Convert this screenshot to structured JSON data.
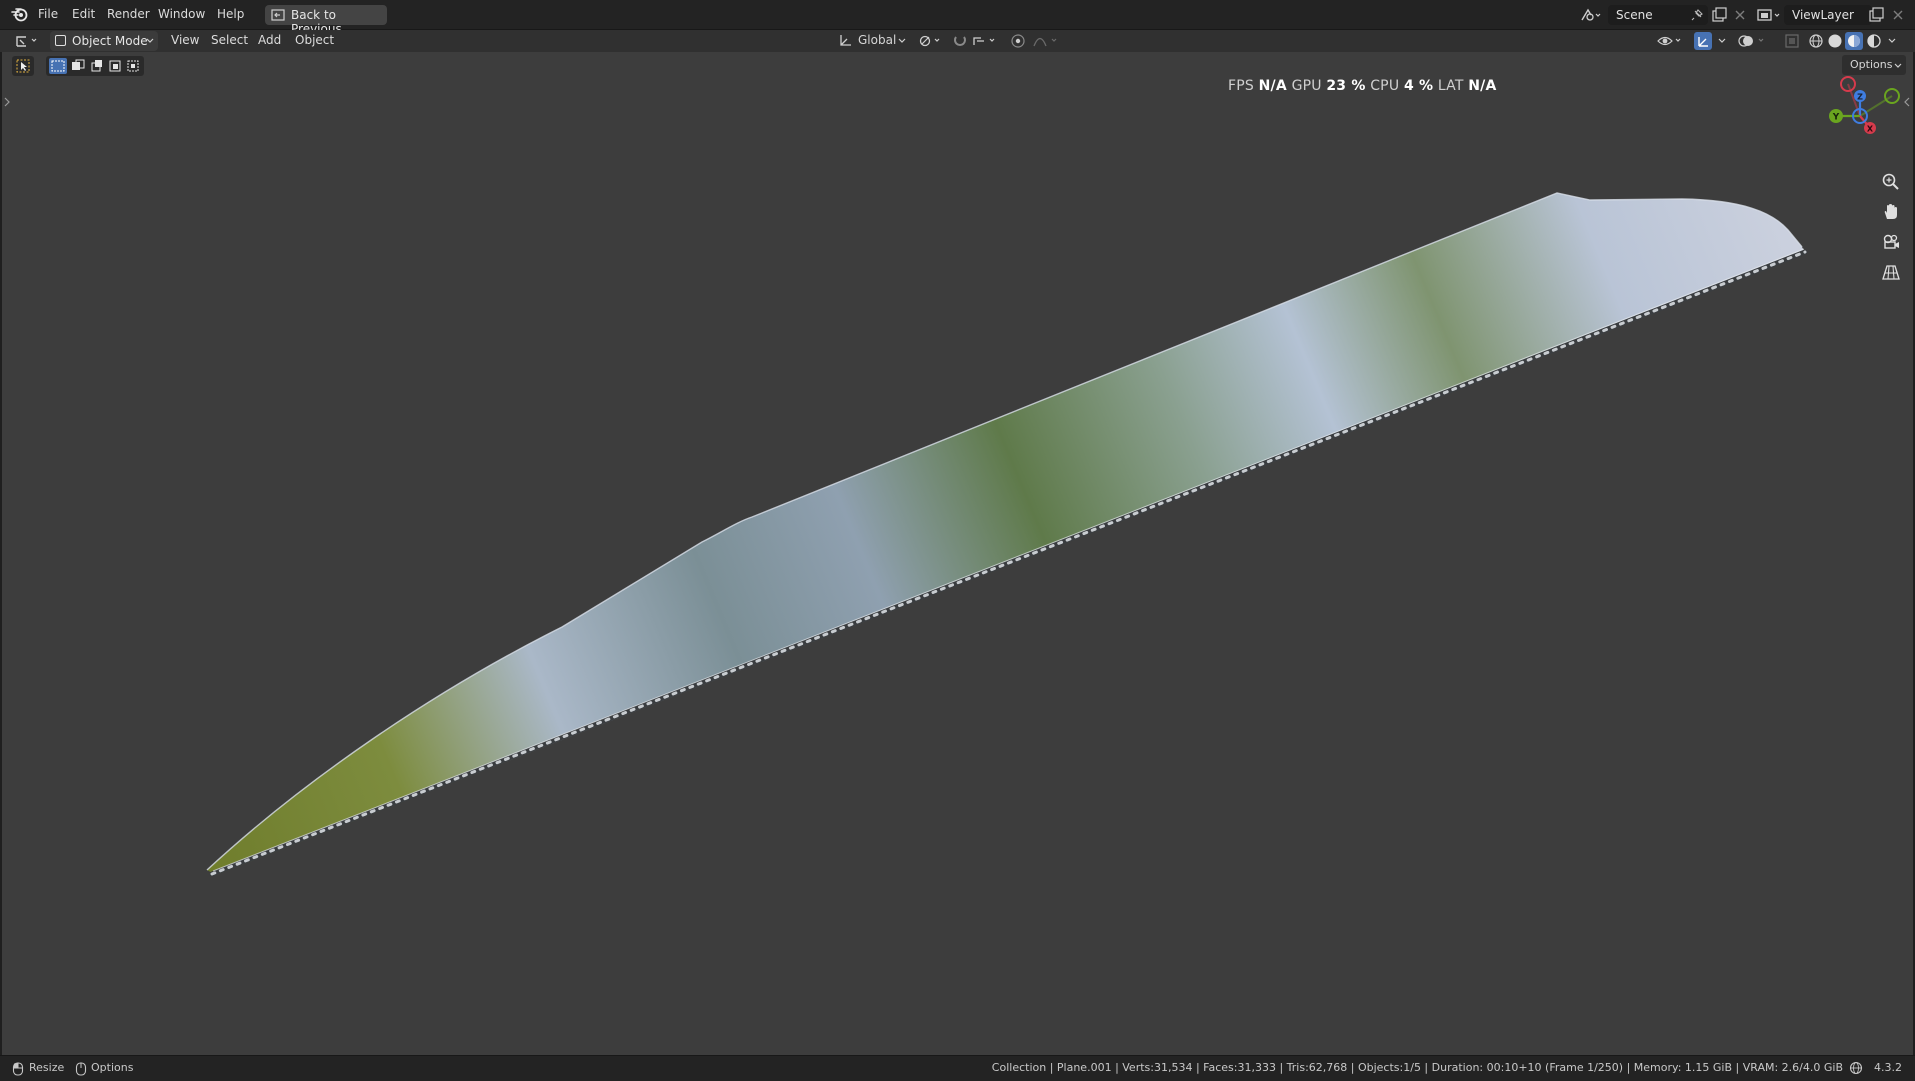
{
  "menu": {
    "file": "File",
    "edit": "Edit",
    "render": "Render",
    "window": "Window",
    "help": "Help",
    "back_button": "Back to Previous"
  },
  "scene": {
    "name": "Scene",
    "view_layer": "ViewLayer"
  },
  "header": {
    "mode": "Object Mode",
    "view": "View",
    "select": "Select",
    "add": "Add",
    "object": "Object",
    "orientation": "Global",
    "options": "Options"
  },
  "stats": {
    "fps_label": "FPS",
    "fps_value": "N/A",
    "gpu_label": "GPU",
    "gpu_value": "23 %",
    "cpu_label": "CPU",
    "cpu_value": "4 %",
    "lat_label": "LAT",
    "lat_value": "N/A"
  },
  "gizmo": {
    "z": "Z",
    "y": "Y",
    "x": "X"
  },
  "statusbar": {
    "resize": "Resize",
    "options": "Options",
    "info": "Collection | Plane.001 | Verts:31,534 | Faces:31,333 | Tris:62,768 | Objects:1/5 | Duration: 00:10+10 (Frame 1/250) | Memory: 1.15 GiB | VRAM: 2.6/4.0 GiB",
    "version": "4.3.2"
  },
  "icons": {
    "app_logo": "blender-logo-icon",
    "editor_type": "3d-viewport-icon",
    "back": "back-icon",
    "scene_type": "scene-icon",
    "pin": "pin-icon",
    "new_scene": "new-scene-icon",
    "close": "close-icon",
    "view_layer_type": "view-layer-icon",
    "new_view_layer": "new-view-layer-icon",
    "select_tool": "select-cursor-icon",
    "select_modes": "select-mode-icons",
    "orientation": "transform-orientation-icon",
    "pivot": "pivot-icon",
    "snap": "snap-icon",
    "proportional": "proportional-edit-icon",
    "visibility": "visibility-icon",
    "gizmo_toggle": "gizmo-icon",
    "overlay": "overlay-icon",
    "xray": "xray-icon",
    "shading_wire": "wireframe-shading-icon",
    "shading_solid": "solid-shading-icon",
    "shading_material": "material-shading-icon",
    "shading_render": "rendered-shading-icon",
    "zoom": "zoom-icon",
    "pan": "hand-pan-icon",
    "camera": "camera-view-icon",
    "ortho": "orthographic-grid-icon",
    "mouse": "mouse-icon",
    "globe": "globe-icon"
  },
  "colors": {
    "accent_blue": "#4772b3",
    "axis_x": "#d63b4c",
    "axis_y": "#6aa51f",
    "axis_z": "#3f7de0"
  }
}
